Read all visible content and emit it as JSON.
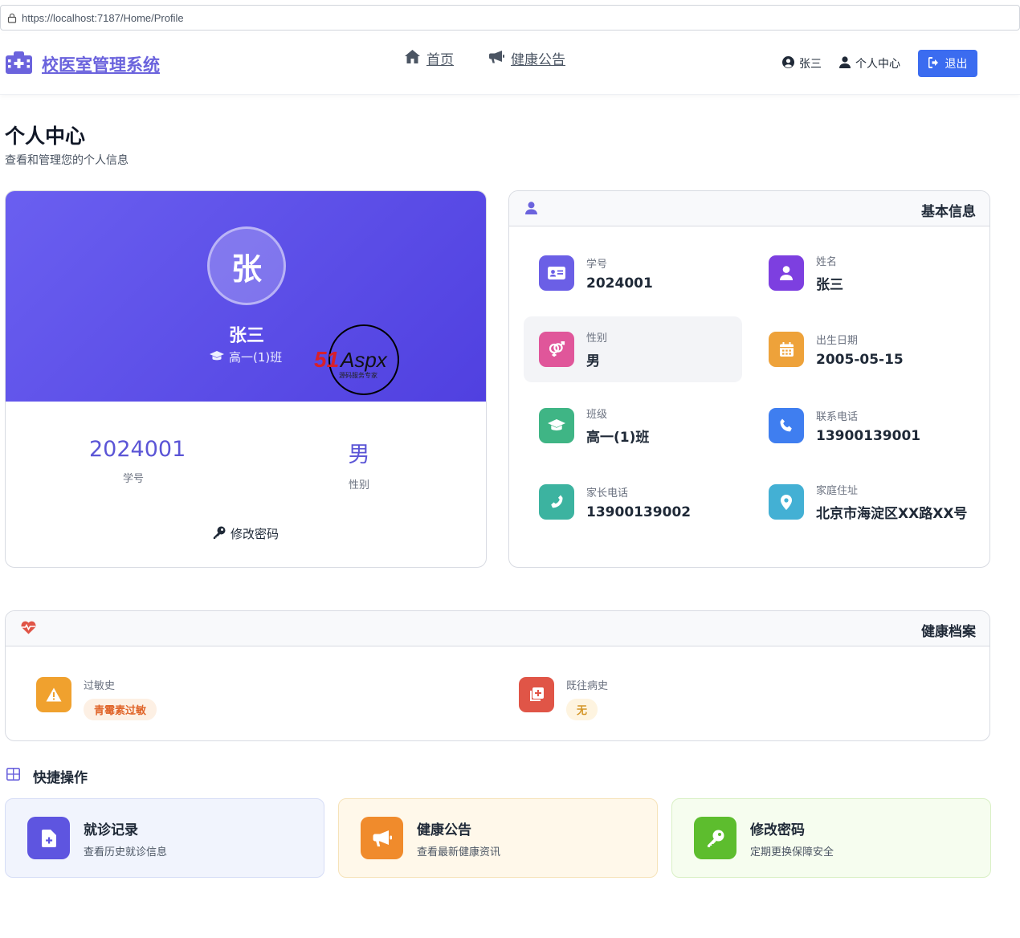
{
  "browser": {
    "url": "https://localhost:7187/Home/Profile"
  },
  "nav": {
    "brand": "校医室管理系统",
    "links": [
      {
        "label": "首页",
        "icon": "home-icon"
      },
      {
        "label": "健康公告",
        "icon": "megaphone-icon"
      }
    ],
    "user_name": "张三",
    "profile_label": "个人中心",
    "logout_label": "退出"
  },
  "page": {
    "title": "个人中心",
    "subtitle": "查看和管理您的个人信息"
  },
  "profile": {
    "avatar_char": "张",
    "name": "张三",
    "class_name": "高一(1)班",
    "stats": [
      {
        "value": "2024001",
        "label": "学号"
      },
      {
        "value": "男",
        "label": "性别"
      }
    ],
    "change_password": "修改密码",
    "watermark": {
      "brand": "51Aspx",
      "tagline": "源码服务专家"
    }
  },
  "basic_info": {
    "title": "基本信息",
    "items": [
      {
        "label": "学号",
        "value": "2024001",
        "icon": "id-card-icon",
        "color": "#6b5fe6"
      },
      {
        "label": "姓名",
        "value": "张三",
        "icon": "user-icon",
        "color": "#7d3fe0"
      },
      {
        "label": "性别",
        "value": "男",
        "icon": "gender-icon",
        "color": "#e0569a"
      },
      {
        "label": "出生日期",
        "value": "2005-05-15",
        "icon": "calendar-icon",
        "color": "#eea23a"
      },
      {
        "label": "班级",
        "value": "高一(1)班",
        "icon": "graduation-cap-icon",
        "color": "#3fb585"
      },
      {
        "label": "联系电话",
        "value": "13900139001",
        "icon": "phone-icon",
        "color": "#3f7ef0"
      },
      {
        "label": "家长电话",
        "value": "13900139002",
        "icon": "phone-icon",
        "color": "#3cb3a0"
      },
      {
        "label": "家庭住址",
        "value": "北京市海淀区XX路XX号",
        "icon": "location-pin-icon",
        "color": "#43b0d4"
      }
    ]
  },
  "health": {
    "title": "健康档案",
    "items": [
      {
        "label": "过敏史",
        "value": "青霉素过敏",
        "icon": "warning-icon",
        "color": "#f0a12e",
        "badge_bg": "#fdf0e4",
        "badge_fg": "#e0652a"
      },
      {
        "label": "既往病史",
        "value": "无",
        "icon": "medical-file-icon",
        "color": "#e05547",
        "badge_bg": "#fef4e0",
        "badge_fg": "#d4962a"
      }
    ]
  },
  "quick": {
    "title": "快捷操作",
    "items": [
      {
        "title": "就诊记录",
        "desc": "查看历史就诊信息",
        "icon": "medical-document-icon",
        "color": "#5e55e0",
        "bg": "#f1f4fd",
        "border": "#d6ddf6"
      },
      {
        "title": "健康公告",
        "desc": "查看最新健康资讯",
        "icon": "megaphone-icon",
        "color": "#f08b2c",
        "bg": "#fff8ea",
        "border": "#f6e3b9"
      },
      {
        "title": "修改密码",
        "desc": "定期更换保障安全",
        "icon": "key-icon",
        "color": "#5dbd2e",
        "bg": "#f6fdef",
        "border": "#d9f0c5"
      }
    ]
  }
}
